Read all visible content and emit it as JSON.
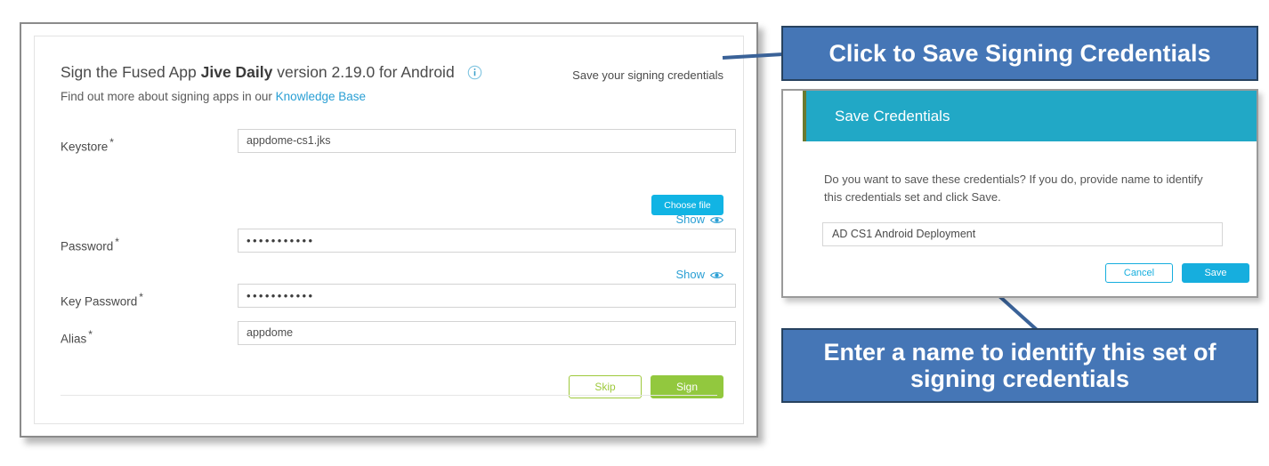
{
  "app": {
    "title_prefix": "Sign the Fused App",
    "title_app_name": "Jive Daily",
    "title_suffix": "version 2.19.0 for Android",
    "info_icon": "info-icon",
    "subtitle_text": "Find out more about signing apps in our",
    "subtitle_link": "Knowledge Base",
    "save_credentials_link": "Save your signing credentials",
    "fields": {
      "keystore_label": "Keystore",
      "keystore_value": "appdome-cs1.jks",
      "choose_file_label": "Choose file",
      "password_label": "Password",
      "password_value": "•••••••••••",
      "password_show_label": "Show",
      "key_password_label": "Key Password",
      "key_password_value": "•••••••••••",
      "key_password_show_label": "Show",
      "alias_label": "Alias",
      "alias_value": "appdome",
      "required_marker": "*"
    },
    "buttons": {
      "skip_label": "Skip",
      "sign_label": "Sign"
    }
  },
  "dialog": {
    "title": "Save Credentials",
    "body": "Do you want to save these credentials? If you do, provide name to identify this credentials set and click Save.",
    "name_value": "AD CS1 Android  Deployment",
    "name_placeholder": "",
    "cancel_label": "Cancel",
    "save_label": "Save"
  },
  "callouts": {
    "top": "Click to Save Signing Credentials",
    "bottom": "Enter a name to identify this set of signing credentials"
  },
  "colors": {
    "callout_fill": "#4576b6",
    "callout_border": "#27425f",
    "dialog_header": "#21a8c6",
    "cyan_button": "#16aede",
    "choose_file_button": "#11b4e4",
    "green_button": "#92c83e",
    "link_blue": "#2a9fd4"
  }
}
